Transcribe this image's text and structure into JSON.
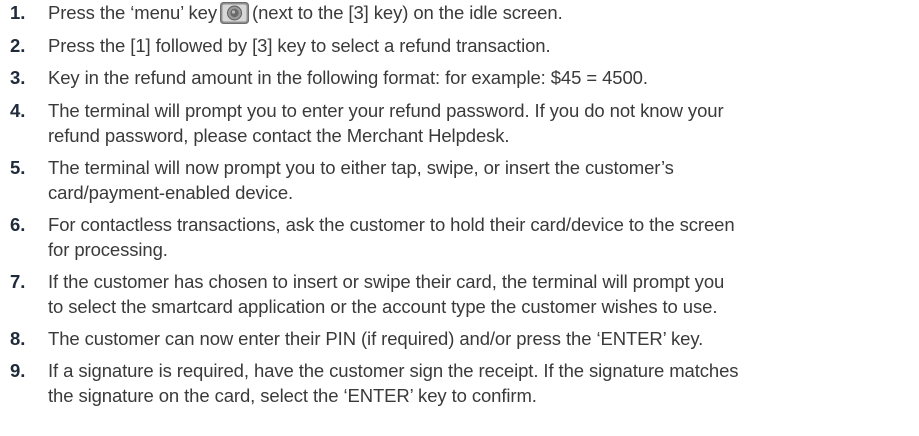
{
  "icons": {
    "menu_key": "menu-key-icon"
  },
  "colors": {
    "text": "#3a3a3a",
    "step_number": "#1f2a3a",
    "key_body": "#8f8f8f",
    "key_face": "#bcbcbc"
  },
  "steps": [
    {
      "number": "1.",
      "pre": "Press the ‘menu’ key",
      "post": "(next to the [3] key) on the idle screen."
    },
    {
      "number": "2.",
      "lines": [
        "Press the [1] followed by [3] key to select a refund transaction."
      ]
    },
    {
      "number": "3.",
      "lines": [
        "Key in the refund amount in the following format: for example: $45 = 4500."
      ]
    },
    {
      "number": "4.",
      "lines": [
        "The terminal will prompt you to enter your refund password. If you do not know your",
        "refund password, please contact the Merchant Helpdesk."
      ]
    },
    {
      "number": "5.",
      "lines": [
        "The terminal will now prompt you to either tap, swipe, or insert the customer’s",
        "card/payment-enabled device."
      ]
    },
    {
      "number": "6.",
      "lines": [
        "For contactless transactions, ask the customer to hold their card/device to the screen",
        "for processing."
      ]
    },
    {
      "number": "7.",
      "lines": [
        "If the customer has chosen to insert or swipe their card, the terminal will prompt you",
        "to select the smartcard application or the account type the customer wishes to use."
      ]
    },
    {
      "number": "8.",
      "lines": [
        "The customer can now enter their PIN (if required) and/or press the ‘ENTER’ key."
      ]
    },
    {
      "number": "9.",
      "lines": [
        "If a signature is required, have the customer sign the receipt. If the signature matches",
        "the signature on the card, select the ‘ENTER’ key to confirm."
      ]
    }
  ]
}
